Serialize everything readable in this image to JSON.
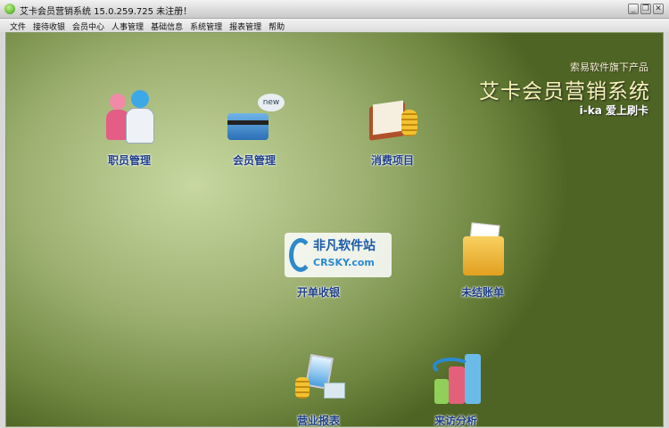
{
  "window": {
    "title": "艾卡会员营销系统 15.0.259.725  未注册！",
    "buttons": [
      "_",
      "❐",
      "✕"
    ]
  },
  "menu": [
    "文件",
    "接待收银",
    "会员中心",
    "人事管理",
    "基础信息",
    "系统管理",
    "报表管理",
    "帮助"
  ],
  "brand": {
    "sub": "索易软件旗下产品",
    "title": "艾卡会员营销系统",
    "slogan": "i-ka  爱上刷卡"
  },
  "tiles": [
    {
      "label": "职员管理",
      "icon": "staff-icon"
    },
    {
      "label": "会员管理",
      "icon": "member-card-icon",
      "badge": "new"
    },
    {
      "label": "消费项目",
      "icon": "consumption-items-icon"
    },
    {
      "label": "开单收银",
      "icon": "checkout-icon"
    },
    {
      "label": "未结账单",
      "icon": "unsettled-bill-icon"
    },
    {
      "label": "营业报表",
      "icon": "business-report-icon"
    },
    {
      "label": "来访分析",
      "icon": "visit-analysis-icon"
    }
  ],
  "watermark": {
    "line1": "非凡软件站",
    "line2": "CRSKY.com"
  },
  "colors": {
    "label": "#1f3f86",
    "brand": "#f8f3b8"
  }
}
